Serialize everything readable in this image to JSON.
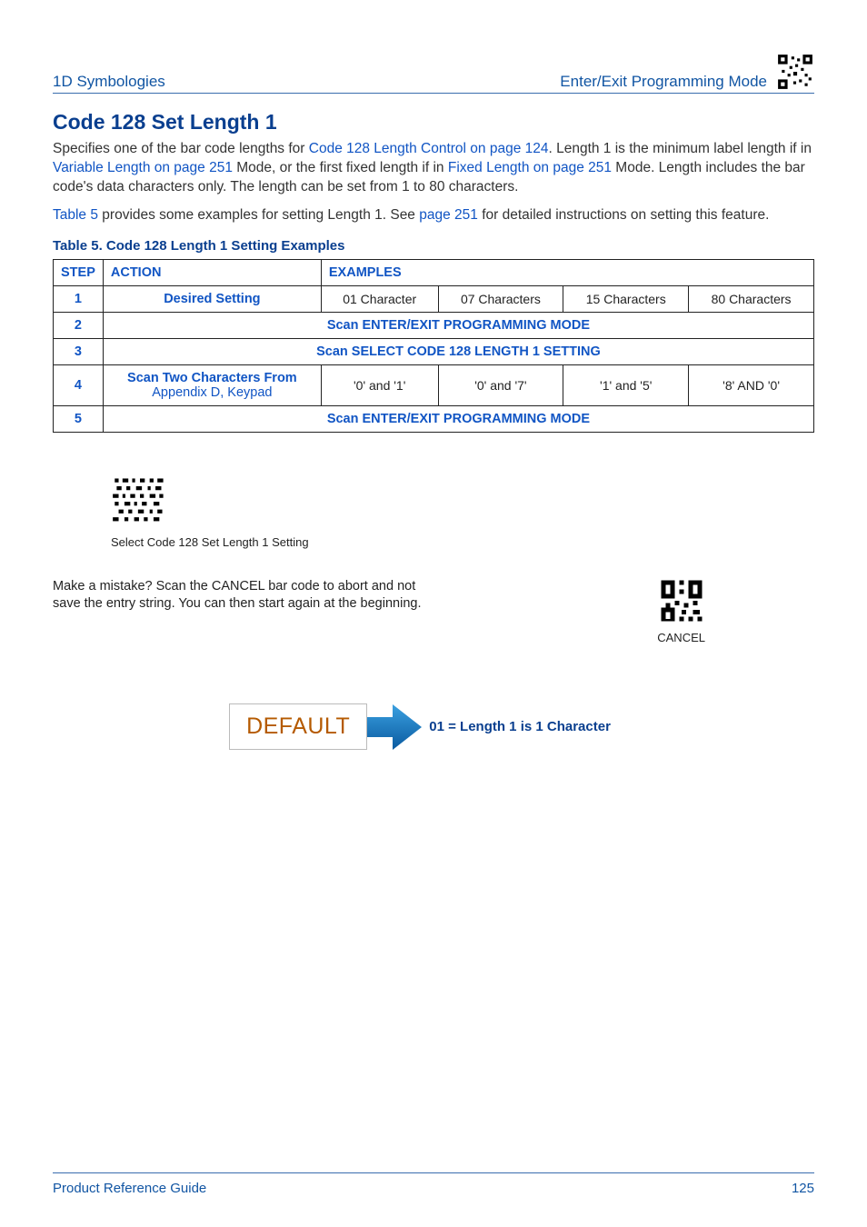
{
  "header": {
    "left": "1D Symbologies",
    "right": "Enter/Exit Programming Mode"
  },
  "section": {
    "title": "Code 128 Set Length 1",
    "para1_a": "Specifies one of the bar code lengths for ",
    "para1_link1": "Code 128 Length Control on page 124",
    "para1_b": ". Length 1 is the minimum label length if in ",
    "para1_link2": "Variable Length on page 251",
    "para1_c": " Mode, or the first fixed length if in ",
    "para1_link3": "Fixed Length on page 251",
    "para1_d": " Mode. Length includes the bar code's data characters only. The length can be set from 1 to 80 characters.",
    "para2_link1": "Table 5",
    "para2_a": " provides some examples for setting Length 1. See ",
    "para2_link2": "page 251",
    "para2_b": " for detailed instructions on setting this feature."
  },
  "table": {
    "caption": "Table 5. Code 128 Length 1 Setting Examples",
    "head": {
      "step": "STEP",
      "action": "ACTION",
      "examples": "EXAMPLES"
    },
    "rows": [
      {
        "step": "1",
        "action": "Desired Setting",
        "cells": [
          "01 Character",
          "07 Characters",
          "15 Characters",
          "80 Characters"
        ]
      },
      {
        "step": "2",
        "full": "Scan ENTER/EXIT PROGRAMMING MODE"
      },
      {
        "step": "3",
        "full": "Scan SELECT CODE 128 LENGTH 1 SETTING"
      },
      {
        "step": "4",
        "action_blue": "Scan Two Characters From ",
        "action_link": "Appendix D, Keypad",
        "cells": [
          "'0' and '1'",
          "'0' and '7'",
          "'1' and '5'",
          "'8' AND '0'"
        ]
      },
      {
        "step": "5",
        "full": "Scan ENTER/EXIT PROGRAMMING MODE"
      }
    ]
  },
  "barcode": {
    "caption": "Select Code 128 Set Length 1 Setting"
  },
  "mistake": {
    "text": "Make a mistake? Scan the CANCEL bar code to abort and not save the entry string. You can then start again at the beginning.",
    "cancel_caption": "CANCEL"
  },
  "default_block": {
    "box": "DEFAULT",
    "label": "01 = Length 1 is 1 Character"
  },
  "footer": {
    "left": "Product Reference Guide",
    "right": "125"
  }
}
